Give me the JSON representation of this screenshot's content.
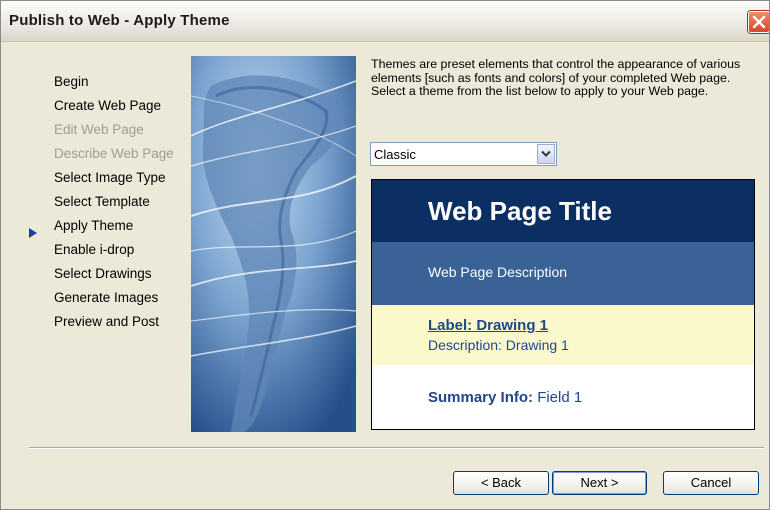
{
  "window": {
    "title": "Publish to Web - Apply Theme"
  },
  "nav": {
    "items": [
      {
        "label": "Begin",
        "enabled": true
      },
      {
        "label": "Create Web Page",
        "enabled": true
      },
      {
        "label": "Edit Web Page",
        "enabled": false
      },
      {
        "label": "Describe Web Page",
        "enabled": false
      },
      {
        "label": "Select Image Type",
        "enabled": true
      },
      {
        "label": "Select Template",
        "enabled": true
      },
      {
        "label": "Apply Theme",
        "enabled": true,
        "current": true
      },
      {
        "label": "Enable i-drop",
        "enabled": true
      },
      {
        "label": "Select Drawings",
        "enabled": true
      },
      {
        "label": "Generate Images",
        "enabled": true
      },
      {
        "label": "Preview and Post",
        "enabled": true
      }
    ]
  },
  "content": {
    "description": "Themes are preset elements that control the appearance of various elements [such as fonts and colors] of your completed Web page.  Select a theme from the list below to apply to your Web page.",
    "theme_select": {
      "value": "Classic"
    },
    "preview": {
      "title": "Web Page Title",
      "description": "Web Page Description",
      "label": "Label: Drawing 1",
      "drawing_description": "Description: Drawing 1",
      "summary_label": "Summary Info:",
      "summary_value": "Field 1"
    }
  },
  "buttons": {
    "back": "< Back",
    "next": "Next >",
    "cancel": "Cancel"
  },
  "colors": {
    "preview_title_bg": "#0b2f63",
    "preview_desc_bg": "#3a6297",
    "preview_label_bg": "#fbf9cc",
    "preview_text": "#1f4789",
    "close_button": "#d9442b"
  },
  "icons": {
    "close": "close-icon",
    "dropdown": "chevron-down-icon",
    "current_step": "triangle-right-icon"
  }
}
